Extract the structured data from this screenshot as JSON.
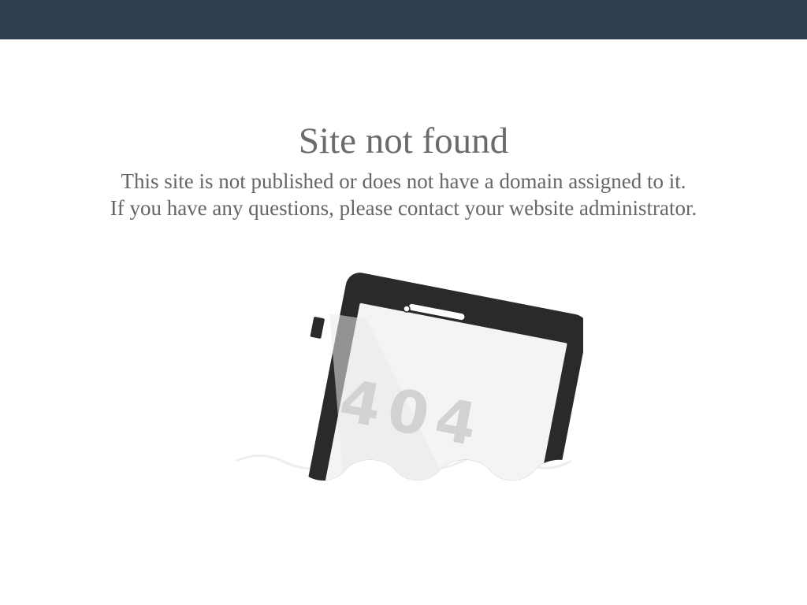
{
  "page": {
    "title": "Site not found",
    "message_line1": "This site is not published or does not have a domain assigned to it.",
    "message_line2": "If you have any questions, please contact your website administrator."
  },
  "illustration": {
    "icon": "tablet-404-icon",
    "code_text": "404"
  },
  "colors": {
    "top_bar": "#2d3e50",
    "text": "#666666",
    "device": "#2a2a2a",
    "screen": "#f3f3f3",
    "code": "#d2d2d2"
  }
}
